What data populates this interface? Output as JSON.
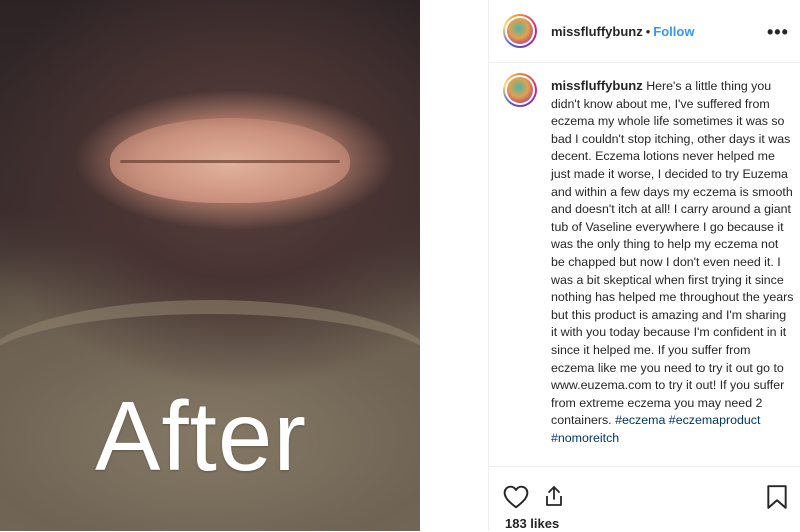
{
  "post": {
    "photo": {
      "caption_text": "After"
    },
    "header": {
      "username": "missfluffybunz",
      "separator": "•",
      "follow_label": "Follow",
      "more_label": "•••"
    },
    "comment": {
      "username": "missfluffybunz",
      "body": "Here's a little thing you didn't know about me, I've suffered from eczema my whole life sometimes it was so bad I couldn't stop itching, other days it was decent. Eczema lotions never helped me just made it worse, I decided to try Euzema and within a few days my eczema is smooth and doesn't itch at all! I carry around a giant tub of Vaseline everywhere I go because it was the only thing to help my eczema not be chapped but now I don't even need it. I was a bit skeptical when first trying it since nothing has helped me throughout the years but this product is amazing and I'm sharing it with you today because I'm confident in it since it helped me. If you suffer from eczema like me you need to try it out go to www.euzema.com to try it out! If you suffer from extreme eczema you may need 2 containers.",
      "hashtags": "#eczema #eczemaproduct #nomoreitch"
    },
    "actions": {
      "like_icon": "heart-icon",
      "share_icon": "share-icon",
      "save_icon": "bookmark-icon"
    },
    "likes_text": "183 likes"
  },
  "colors": {
    "link_blue": "#3897f0",
    "hashtag_blue": "#003569",
    "text": "#262626",
    "border": "#efefef"
  }
}
